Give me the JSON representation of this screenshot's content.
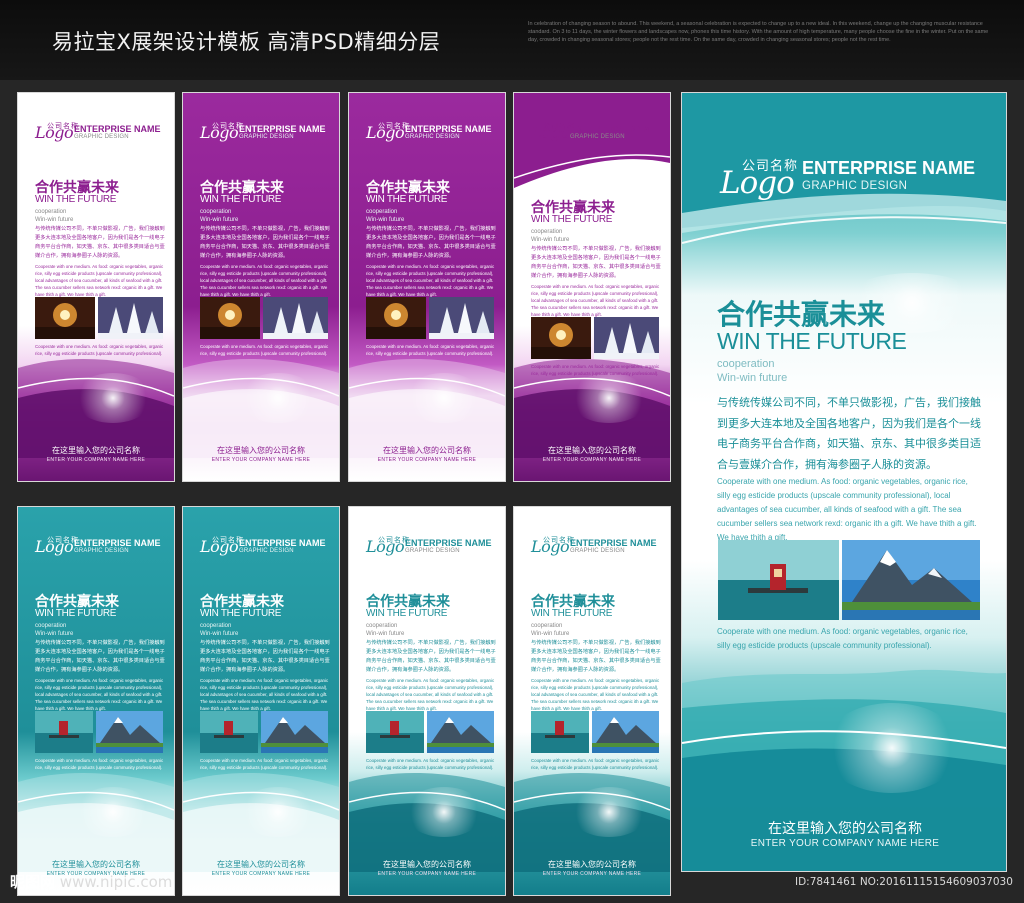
{
  "header": {
    "title": "易拉宝X展架设计模板 高清PSD精细分层",
    "small_text": "In celebration of changing season to abound. This weekend, a seasonal celebration is expected to change up to a new ideal. In this weekend, change up the changing muscular resistance standard. On 3 to 11 days, the winter flowers and landscapes now, phones this time history. With the amount of high temperature, many people choose the fine in the winter. Put on the same day, crowded in changing seasonal stores; people not the rest time. On the same day, crowded in changing seasonal stores; people not the rest time."
  },
  "banner": {
    "logo_cn": "公司名称",
    "logo_en": "Logo",
    "enterprise": "ENTERPRISE NAME",
    "graphic": "GRAPHIC DESIGN",
    "heading_cn": "合作共赢未来",
    "heading_en": "WIN THE FUTURE",
    "coop1": "cooperation",
    "coop2": "Win-win future",
    "para_cn": "与传统传媒公司不同，不单只做影视，广告，我们接触到更多大连本地及全国各地客户，因为我们是各个一线电子商务平台合作商，如天猫、京东、其中很多类目适合与壹媒介合作，拥有海参圈子人脉的资源。",
    "para_en": "Cooperate with one medium. As food: organic vegetables, organic rice, silly egg esticide products (upscale community professional), local advantages of sea cucumber, all kinds of seafood with a gift. The sea cucumber sellers sea network rexd: organic ith a gift. We have thith a gift. We have thith a gift.",
    "para_en2": "Cooperate with one medium. As food: organic vegetables, organic rice, silly egg esticide products (upscale community professional).",
    "footer_cn": "在这里输入您的公司名称",
    "footer_en": "ENTER YOUR COMPANY NAME HERE"
  },
  "big": {
    "para_en": "Cooperate with one medium. As food: organic vegetables, organic rice, silly egg esticide products (upscale community professional), local advantages of sea cucumber, all kinds of seafood with a gift. The sea cucumber sellers sea network rexd: organic ith a gift. We have thith a gift. We have thith a gift.",
    "para_en2": "Cooperate with one medium. As food: organic vegetables, organic rice, silly egg esticide products (upscale community professional)."
  },
  "watermark": {
    "brand": "昵图网",
    "url": "www.nipic.com"
  },
  "image_id": "ID:7841461 NO:20161115154609037030",
  "colors": {
    "purple": "#8b1f8e",
    "purple_dark": "#5b0f66",
    "teal": "#2a9aa3",
    "teal_dark": "#137a86",
    "text_gray": "#555555"
  }
}
